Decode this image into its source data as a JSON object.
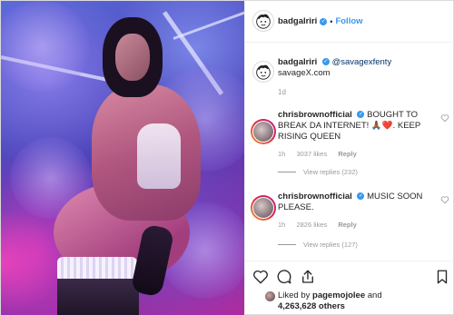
{
  "post": {
    "author": {
      "username": "badgalriri",
      "verified_icon": "verified-badge-icon",
      "follow_label": "Follow",
      "separator": "•"
    },
    "caption": {
      "username": "badgalriri",
      "mention": "@savagexfenty",
      "text": "savageX.com",
      "time": "1d"
    },
    "comments": [
      {
        "username": "chrisbrownofficial",
        "text": "BOUGHT TO BREAK DA INTERNET! 🙏🏾❤️. KEEP RISING QUEEN",
        "time": "1h",
        "likes": "3037 likes",
        "reply_label": "Reply",
        "view_replies": "View replies (232)"
      },
      {
        "username": "chrisbrownofficial",
        "text": "MUSIC SOON PLEASE.",
        "time": "1h",
        "likes": "2826 likes",
        "reply_label": "Reply",
        "view_replies": "View replies (127)"
      }
    ],
    "likes": {
      "prefix": "Liked by",
      "liker": "pagemojolee",
      "connector": "and",
      "count": "4,263,628",
      "suffix": "others"
    },
    "actions": [
      "heart-icon",
      "comment-icon",
      "share-icon",
      "bookmark-icon"
    ]
  },
  "colors": {
    "accent": "#3897f0",
    "text": "#262626",
    "muted": "#999999",
    "border": "#efefef"
  }
}
